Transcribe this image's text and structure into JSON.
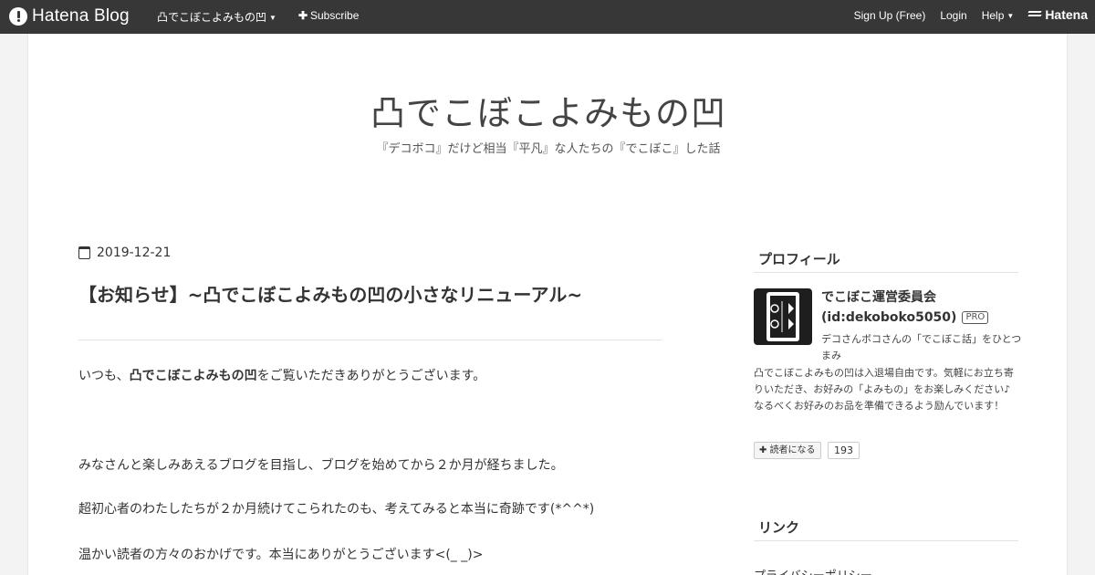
{
  "topbar": {
    "brand": "Hatena Blog",
    "blog_menu": "凸でこぼこよみもの凹",
    "subscribe": "Subscribe",
    "signup": "Sign Up (Free)",
    "login": "Login",
    "help": "Help",
    "hatena": "Hatena"
  },
  "header": {
    "title": "凸でこぼこよみもの凹",
    "description": "『デコボコ』だけど相当『平凡』な人たちの『でこぼこ』した話"
  },
  "article": {
    "date": "2019-12-21",
    "title": "【お知らせ】~凸でこぼこよみもの凹の小さなリニューアル~",
    "p1_pre": "いつも、",
    "p1_bold": "凸でこぼこよみもの凹",
    "p1_post": "をご覧いただきありがとうございます。",
    "p2": "みなさんと楽しみあえるブログを目指し、ブログを始めてから２か月が経ちました。",
    "p3": "超初心者のわたしたちが２か月続けてこられたのも、考えてみると本当に奇跡です(*^^*)",
    "p4": "温かい読者の方々のおかげです。本当にありがとうございます<(_ _)>"
  },
  "sidebar": {
    "profile_heading": "プロフィール",
    "profile_name": "でこぼこ運営委員会",
    "profile_id": "(id:dekoboko5050)",
    "pro_badge": "PRO",
    "desc1": "デコさんボコさんの「でこぼこ話」をひとつまみ",
    "desc2": "凸でこぼこよみもの凹は入退場自由です。気軽にお立ち寄りいただき、お好みの「よみもの」をお楽しみください♪ なるべくお好みのお品を準備できるよう励んでいます！",
    "subscribe_label": "読者になる",
    "subscriber_count": "193",
    "links_heading": "リンク",
    "link_privacy": "プライバシーポリシー"
  },
  "colors": {
    "topbar": "#373737",
    "page_bg": "#f3f3f3",
    "content_bg": "#ffffff",
    "text": "#333333"
  }
}
